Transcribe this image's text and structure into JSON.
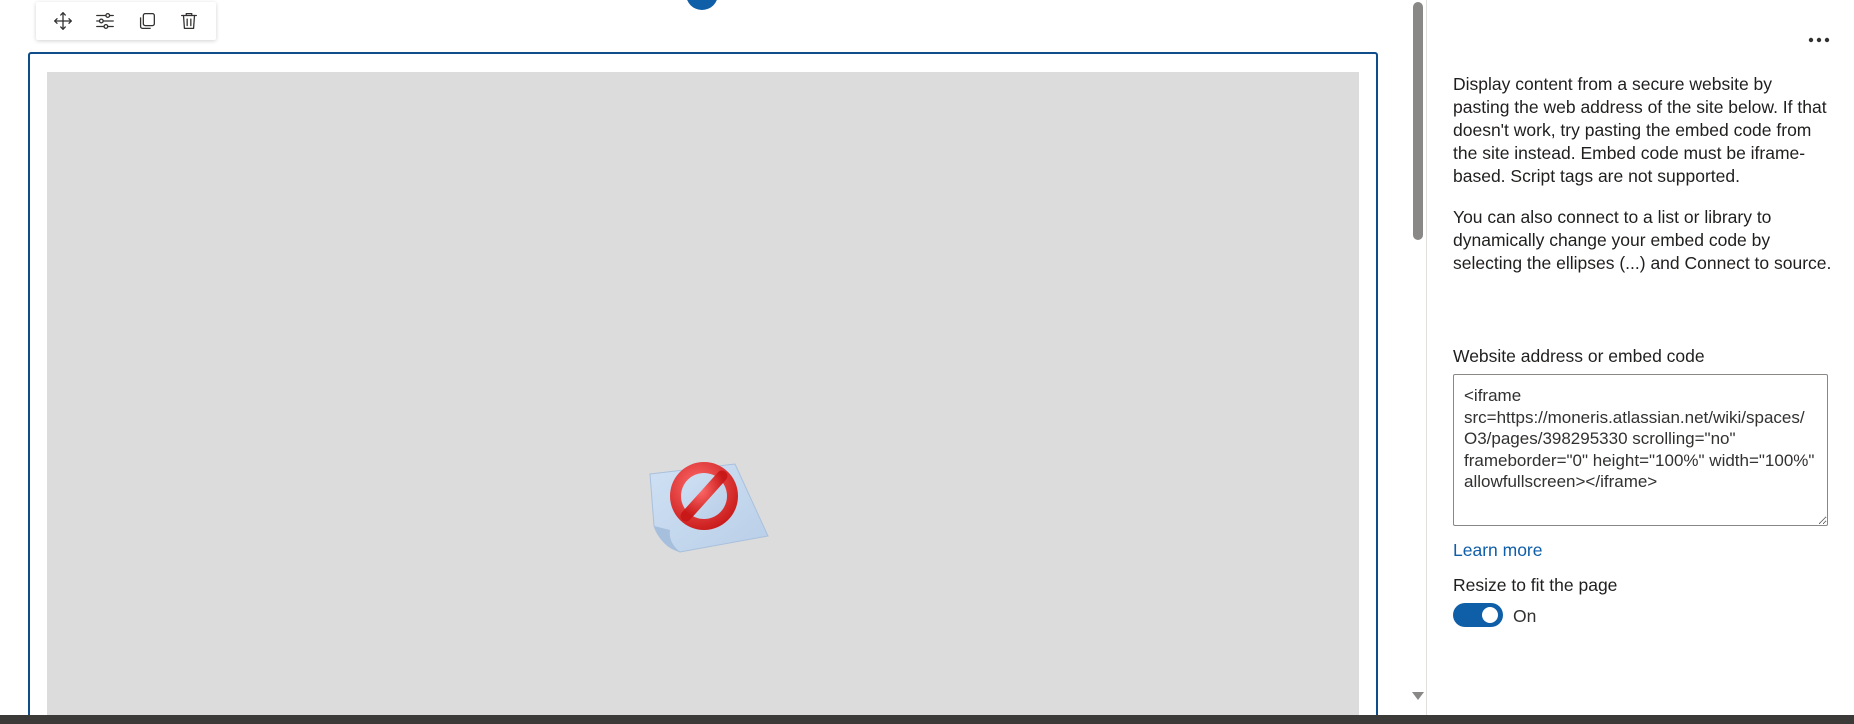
{
  "toolbar": {
    "items": [
      {
        "icon": "move-icon",
        "label": "Move web part"
      },
      {
        "icon": "settings-icon",
        "label": "Edit properties"
      },
      {
        "icon": "duplicate-icon",
        "label": "Duplicate web part"
      },
      {
        "icon": "delete-icon",
        "label": "Delete web part"
      }
    ]
  },
  "preview": {
    "state": "blocked",
    "icon": "blocked-content-icon"
  },
  "property_pane": {
    "more_icon": "more-options-icon",
    "description_1": "Display content from a secure website by pasting the web address of the site below. If that doesn't work, try pasting the embed code from the site instead. Embed code must be iframe-based. Script tags are not supported.",
    "description_2": "You can also connect to a list or library to dynamically change your embed code by selecting the ellipses (...) and Connect to source.",
    "field_label": "Website address or embed code",
    "embed_code": "<iframe src=https://moneris.atlassian.net/wiki/spaces/O3/pages/398295330 scrolling=\"no\" frameborder=\"0\" height=\"100%\" width=\"100%\" allowfullscreen></iframe>",
    "learn_more": "Learn more",
    "resize_label": "Resize to fit the page",
    "resize_state": "On",
    "resize_on": true
  },
  "colors": {
    "accent": "#0f5ea8",
    "frame_border": "#0f4c8a",
    "preview_bg": "#dcdcdc",
    "scroll_thumb": "#8a8886"
  }
}
